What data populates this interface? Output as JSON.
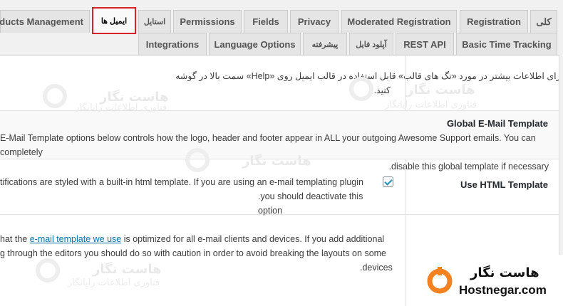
{
  "tabs_row1": [
    {
      "label": "کلی"
    },
    {
      "label": "Registration"
    },
    {
      "label": "Moderated Registration"
    },
    {
      "label": "Privacy"
    },
    {
      "label": "Fields"
    },
    {
      "label": "Permissions"
    },
    {
      "label": "استایل"
    },
    {
      "label": "ایمیل ها"
    },
    {
      "label": "ducts Management"
    }
  ],
  "tabs_row2": [
    {
      "label": "Basic Time Tracking"
    },
    {
      "label": "REST API"
    },
    {
      "label": "آپلود فایل"
    },
    {
      "label": "پیشرفته"
    },
    {
      "label": "Language Options"
    },
    {
      "label": "Integrations"
    }
  ],
  "info": {
    "line1": "برای اطلاعات بیشتر در مورد «تگ های قالب» قابل استفاده در قالب ایمیل روی «Help» سمت بالا در گوشه",
    "line2": "کنید."
  },
  "global": {
    "heading": "Global E-Mail Template",
    "desc1": "E-Mail Template options below controls how the logo, header and footer appear in ALL your outgoing Awesome Support emails. You can completely",
    "desc2": ".disable this global template if necessary"
  },
  "use_html": {
    "label": "Use HTML Template",
    "desc1": "tifications are styled with a built-in html template. If you are using an e-mail templating plugin",
    "desc2": ".you should deactivate this option",
    "checked": true
  },
  "template_note": {
    "pre": "hat the ",
    "link": "e-mail template we use",
    "post": " is optimized for all e-mail clients and devices. If you add additional",
    "line2": "g through the editors you should do so with caution in order to avoid breaking the layouts on some",
    "line3": ".devices"
  },
  "watermark": {
    "brand_fa": "هاست نگار",
    "tagline_fa": "فناوری اطلاعات رایانگار"
  },
  "logo": {
    "name_fa": "هاست نگار",
    "name_en": "Hostnegar.com",
    "accent": "#f58220"
  },
  "colors": {
    "active_tab_border": "#d9232a",
    "link": "#0073aa"
  }
}
